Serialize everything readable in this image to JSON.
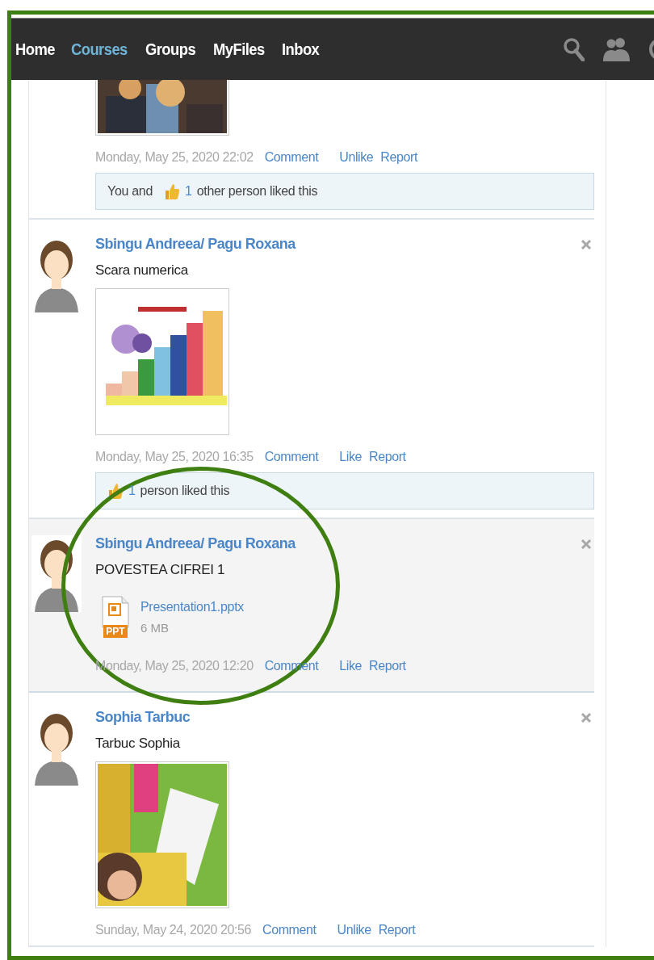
{
  "nav": {
    "items": [
      {
        "label": "Home",
        "selected": false
      },
      {
        "label": "Courses",
        "selected": true
      },
      {
        "label": "Groups",
        "selected": false
      },
      {
        "label": "MyFiles",
        "selected": false
      },
      {
        "label": "Inbox",
        "selected": false
      }
    ]
  },
  "posts": [
    {
      "attachment": {
        "kind": "picture",
        "cropped": true
      },
      "timestamp": "Monday, May 25, 2020 22:02",
      "actions": [
        "Comment",
        "Unlike",
        "Report"
      ],
      "likes": {
        "prefix": "You and",
        "count": "1",
        "suffix": "other person liked this"
      },
      "highlighted": false
    },
    {
      "author": "Sbingu Andreea/ Pagu Roxana",
      "message": "Scara numerica",
      "removable": true,
      "attachment": {
        "kind": "picture",
        "cropped": false
      },
      "timestamp": "Monday, May 25, 2020 16:35",
      "actions": [
        "Comment",
        "Like",
        "Report"
      ],
      "likes": {
        "count": "1",
        "suffix": "person liked this"
      },
      "highlighted": false
    },
    {
      "author": "Sbingu Andreea/ Pagu Roxana",
      "message": "POVESTEA CIFREI 1",
      "removable": true,
      "attachment": {
        "kind": "file",
        "badge": "PPT",
        "name": "Presentation1.pptx",
        "size": "6 MB"
      },
      "timestamp": "Monday, May 25, 2020 12:20",
      "actions": [
        "Comment",
        "Like",
        "Report"
      ],
      "highlighted": true
    },
    {
      "author": "Sophia Tarbuc",
      "message": "Tarbuc Sophia",
      "removable": true,
      "attachment": {
        "kind": "picture",
        "cropped": false
      },
      "timestamp": "Sunday, May 24, 2020 20:56",
      "actions": [
        "Comment",
        "Unlike",
        "Report"
      ],
      "highlighted": false
    }
  ]
}
